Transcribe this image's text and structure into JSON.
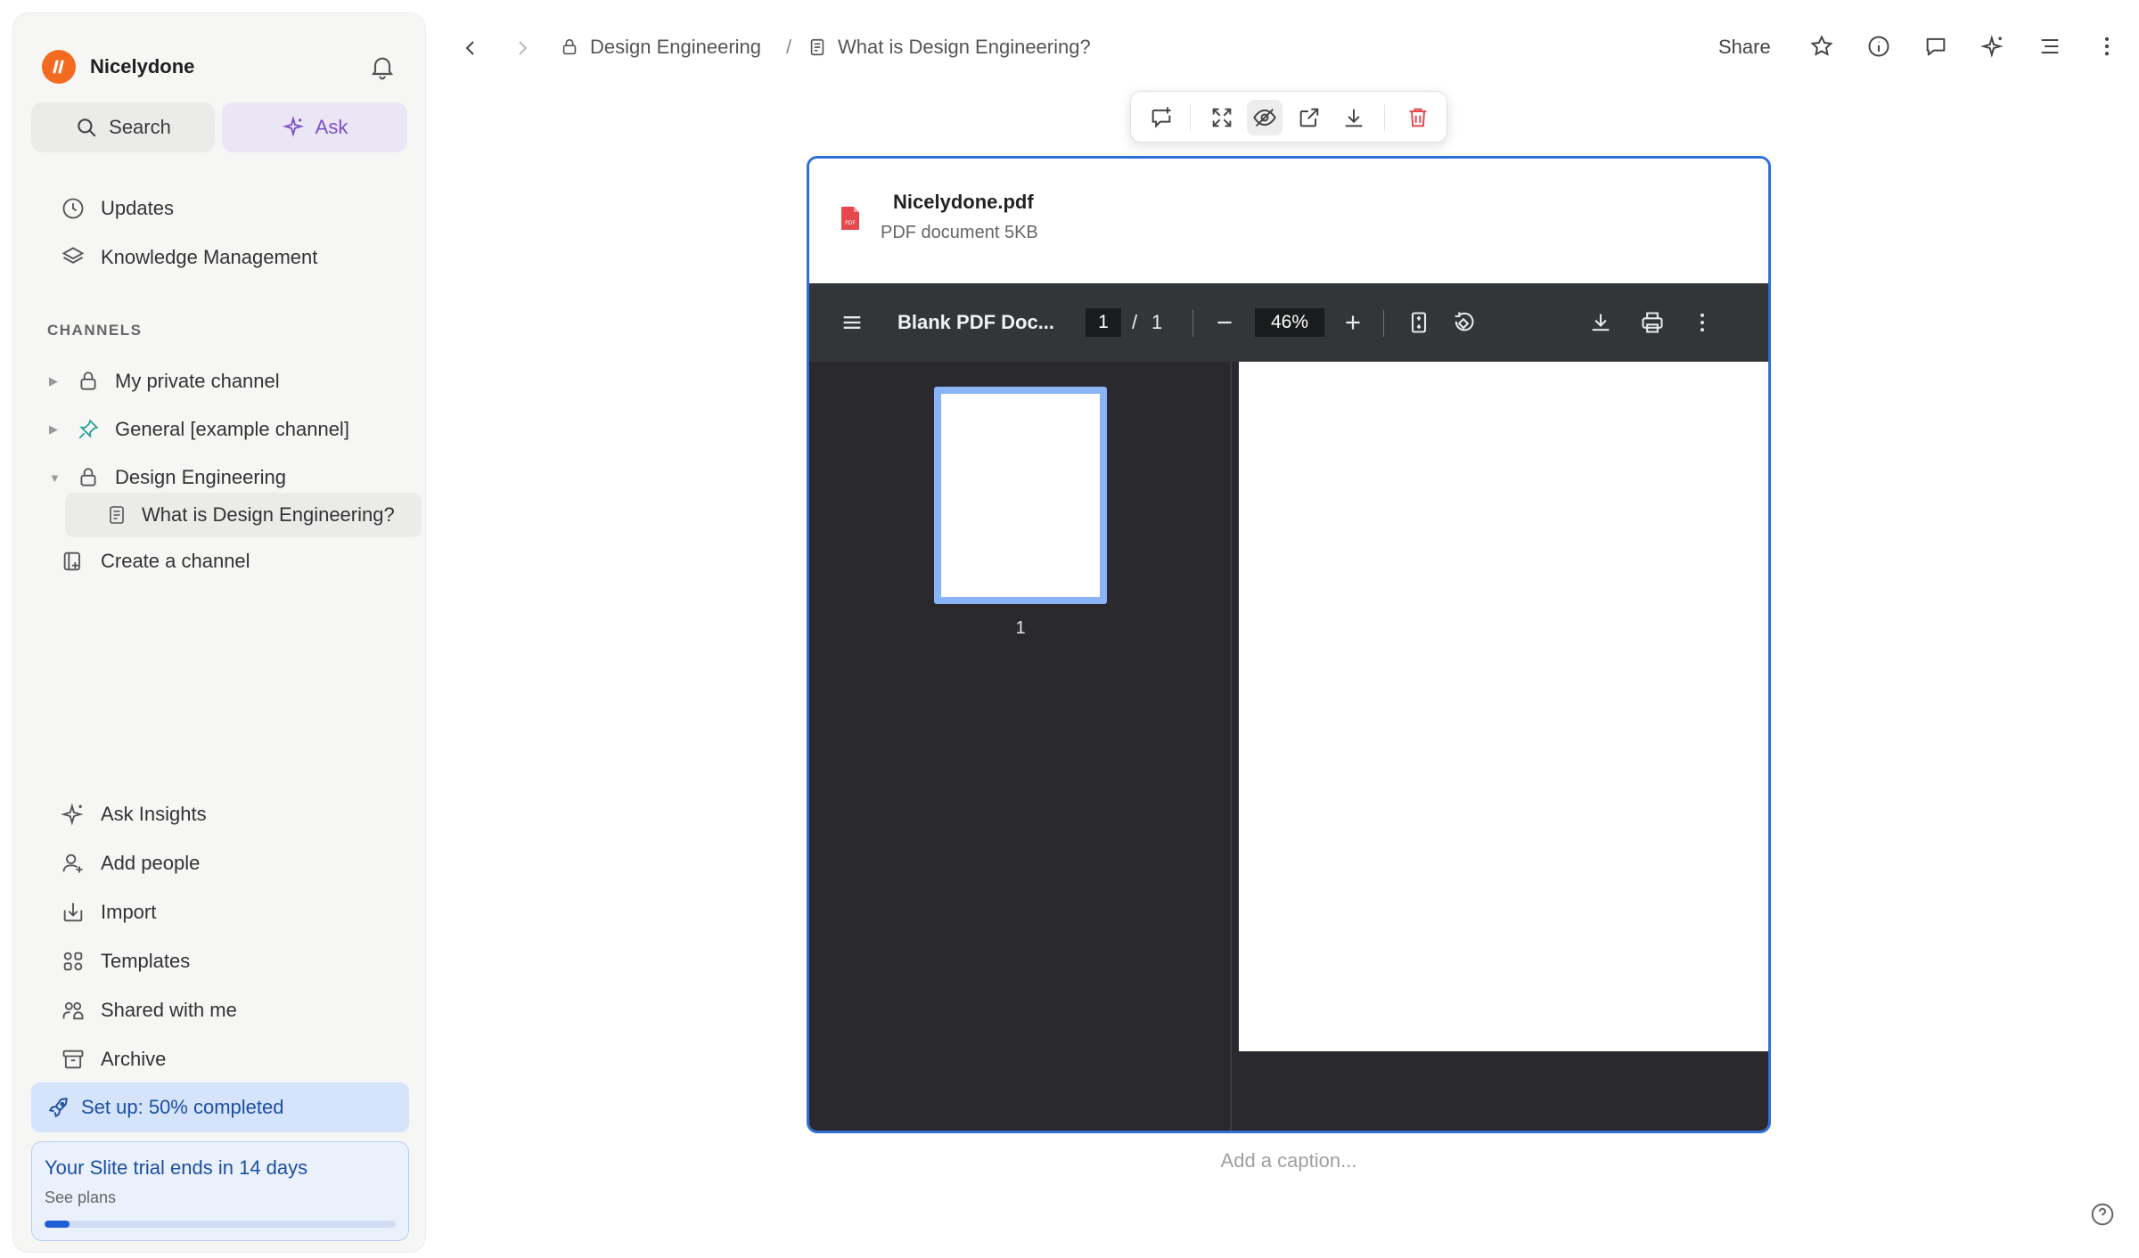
{
  "sidebar": {
    "workspace_name": "Nicelydone",
    "search_label": "Search",
    "ask_label": "Ask",
    "nav": [
      {
        "label": "Updates",
        "icon": "clock-icon"
      },
      {
        "label": "Knowledge Management",
        "icon": "layers-icon"
      }
    ],
    "channels_heading": "CHANNELS",
    "channels": [
      {
        "label": "My private channel",
        "icon": "lock-icon",
        "expanded": false
      },
      {
        "label": "General [example channel]",
        "icon": "pin-icon",
        "expanded": false
      },
      {
        "label": "Design Engineering",
        "icon": "lock-icon",
        "expanded": true
      }
    ],
    "active_doc": "What is Design Engineering?",
    "create_channel": "Create a channel",
    "bottom_nav": [
      {
        "label": "Ask Insights",
        "icon": "sparkle-icon"
      },
      {
        "label": "Add people",
        "icon": "add-person-icon"
      },
      {
        "label": "Import",
        "icon": "import-icon"
      },
      {
        "label": "Templates",
        "icon": "templates-icon"
      },
      {
        "label": "Shared with me",
        "icon": "shared-icon"
      },
      {
        "label": "Archive",
        "icon": "archive-icon"
      }
    ],
    "setup_label": "Set up: 50% completed",
    "trial_title": "Your Slite trial ends in 14 days",
    "trial_link": "See plans",
    "trial_progress": 0.07
  },
  "topbar": {
    "breadcrumb_channel": "Design Engineering",
    "breadcrumb_separator": "/",
    "breadcrumb_doc": "What is Design Engineering?",
    "share_label": "Share"
  },
  "embed": {
    "file_name": "Nicelydone.pdf",
    "file_meta": "PDF document 5KB",
    "viewer_title": "Blank PDF Doc...",
    "current_page": "1",
    "page_separator": "/",
    "total_pages": "1",
    "zoom": "46%",
    "thumbnail_label": "1",
    "caption_placeholder": "Add a caption..."
  },
  "colors": {
    "brand": "#f26b21",
    "accent": "#2f6fd8",
    "ask": "#7b4fc8",
    "danger": "#e5484d"
  }
}
